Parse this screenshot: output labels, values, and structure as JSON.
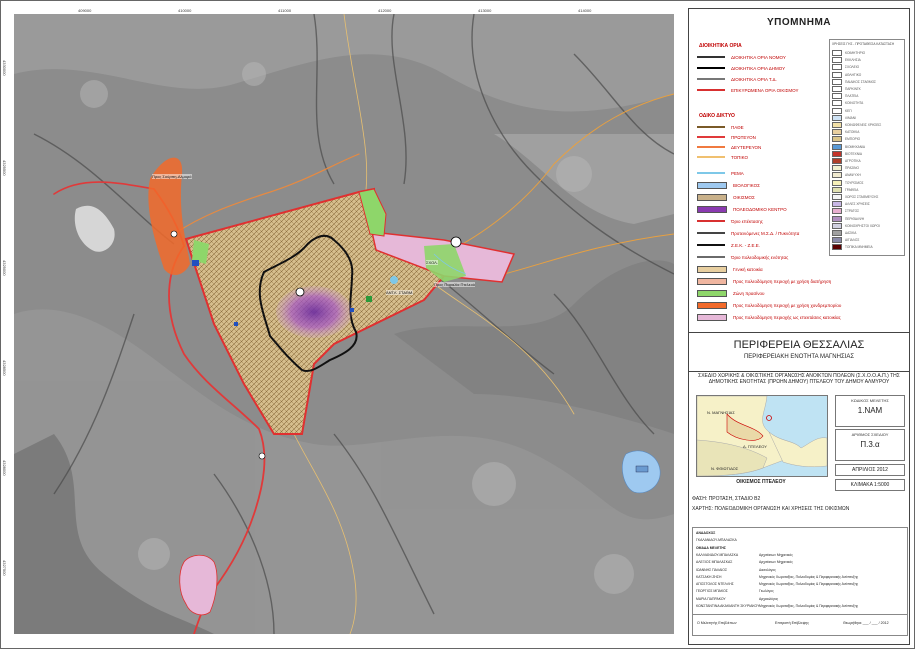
{
  "legend": {
    "title": "ΥΠΟΜΝΗΜΑ",
    "admin_heading": "ΔΙΟΙΚΗΤΙΚΑ ΟΡΙΑ",
    "admin_items": [
      {
        "label": "ΔΙΟΙΚΗΤΙΚΑ ΟΡΙΑ ΝΟΜΟΥ",
        "color": "#333333"
      },
      {
        "label": "ΔΙΟΙΚΗΤΙΚΑ ΟΡΙΑ ΔΗΜΟΥ",
        "color": "#000000"
      },
      {
        "label": "ΔΙΟΙΚΗΤΙΚΑ ΟΡΙΑ Τ.Δ.",
        "color": "#777777"
      },
      {
        "label": "ΕΠΙΚΥΡΩΜΕΝΑ ΟΡΙΑ ΟΙΚΙΣΜΟΥ",
        "color": "#d83030"
      }
    ],
    "road_heading": "ΟΔΙΚΟ ΔΙΚΤΥΟ",
    "road_items": [
      {
        "label": "ΠΑΘΕ",
        "color": "#7a5a28"
      },
      {
        "label": "ΠΡΩΤΕΥΟΝ",
        "color": "#e03a3a"
      },
      {
        "label": "ΔΕΥΤΕΡΕΥΟΝ",
        "color": "#f07a40"
      },
      {
        "label": "ΤΟΠΙΚΟ",
        "color": "#f0c070"
      }
    ],
    "other_items": [
      {
        "label": "ΡΕΜΑ",
        "color": "#7ec8e8",
        "kind": "line"
      },
      {
        "label": "ΒΙΟΛΟΓΙΚΟΣ",
        "color": "#9ec9f0",
        "kind": "fill"
      },
      {
        "label": "ΟΙΚΙΣΜΟΣ",
        "color": "#c9b18a",
        "kind": "fill"
      },
      {
        "label": "ΠΟΛΕΟΔΟΜΙΚΟ ΚΕΝΤΡΟ",
        "color": "#8a3ab0",
        "kind": "fill"
      },
      {
        "label": "Όριο επέκτασης",
        "color": "#d83030",
        "kind": "line"
      },
      {
        "label": "Προτεινόμενες Μ.Σ.Δ. / Πυκνότητα",
        "color": "#444444",
        "kind": "line"
      },
      {
        "label": "Ζ.Ε.Κ. - Ζ.Ε.Ε.",
        "color": "#111111",
        "kind": "line"
      },
      {
        "label": "Όριο πολεοδομικής ενότητας",
        "color": "#6a6a6a",
        "kind": "line"
      },
      {
        "label": "Γενική κατοικία",
        "color": "#e8cfa0",
        "kind": "fill"
      },
      {
        "label": "Προς πολεοδόμηση περιοχή με χρήση διατήρηση",
        "color": "#f0b6a0",
        "kind": "fill"
      },
      {
        "label": "Ζώνη πρασίνου",
        "color": "#8ed66a",
        "kind": "fill"
      },
      {
        "label": "Προς πολεοδόμηση περιοχή με χρήση χονδρεμπορίου",
        "color": "#f26a2a",
        "kind": "fill"
      },
      {
        "label": "Προς πολεοδόμηση περιοχής ως επεκτάσεις κατοικίας",
        "color": "#e6b8d8",
        "kind": "fill"
      }
    ],
    "right_table_title": "ΧΡΗΣΕΙΣ ΓΗΣ - ΠΡΟΤΑΘΕΙΣΑ ΚΑΤΑΣΤΑΣΗ",
    "right_table": [
      {
        "label": "ΚΟΙΜΗΤΗΡΙΟ",
        "color": "#ffffff"
      },
      {
        "label": "ΕΚΚΛΗΣΙΑ",
        "color": "#ffffff"
      },
      {
        "label": "ΣΧΟΛΕΙΟ",
        "color": "#ffffff"
      },
      {
        "label": "ΑΘΛΗΤΙΚΟ",
        "color": "#ffffff"
      },
      {
        "label": "ΠΑΙΔΙΚΟΣ ΣΤΑΘΜΟΣ",
        "color": "#ffffff"
      },
      {
        "label": "ΠΑΡΚΙΝΓΚ",
        "color": "#ffffff"
      },
      {
        "label": "ΠΛΑΤΕΙΑ",
        "color": "#ffffff"
      },
      {
        "label": "ΚΟΙΝΟΤΗΤΑ",
        "color": "#ffffff"
      },
      {
        "label": "ΚΕΠ",
        "color": "#ffffff"
      },
      {
        "label": "ΛΙΜΑΝΙ",
        "color": "#cfe3f5"
      },
      {
        "label": "ΚΟΙΝΩΦΕΛΕΙΣ ΧΡΗΣΕΙΣ",
        "color": "#f3e1a8"
      },
      {
        "label": "ΚΑΤΟΙΚΙΑ",
        "color": "#e8cfa0"
      },
      {
        "label": "ΕΜΠΟΡΙΟ",
        "color": "#d9c48a"
      },
      {
        "label": "ΒΙΟΜΗΧΑΝΙΑ",
        "color": "#5a9ad6"
      },
      {
        "label": "ΒΙΟΤΕΧΝΙΑ",
        "color": "#c4342a"
      },
      {
        "label": "ΑΓΡΟΤΙΚΑ",
        "color": "#b0402a"
      },
      {
        "label": "ΠΡΑΣΙΝΟ",
        "color": "#f2f2d0"
      },
      {
        "label": "ΑΝΑΨΥΧΗ",
        "color": "#f0ead0"
      },
      {
        "label": "ΤΟΥΡΙΣΜΟΣ",
        "color": "#f6f0b8"
      },
      {
        "label": "ΓΡΑΦΕΙΑ",
        "color": "#e0e0b0"
      },
      {
        "label": "ΧΩΡΟΣ ΣΤΑΘΜΕΥΣΗΣ",
        "color": "#f5f5f5"
      },
      {
        "label": "ΑΛΛΕΣ ΧΡΗΣΕΙΣ",
        "color": "#c9b8e6"
      },
      {
        "label": "ΣΤΡΑΤΟΣ",
        "color": "#e8b0d0"
      },
      {
        "label": "ΠΕΡΙΘΑΛΨΗ",
        "color": "#b090c0"
      },
      {
        "label": "ΚΟΙΝΟΧΡΗΣΤΟΙ ΧΩΡΟΙ",
        "color": "#d0d0e0"
      },
      {
        "label": "ΔΑΣΙΚΑ",
        "color": "#a0a0a0"
      },
      {
        "label": "ΑΙΓΙΑΛΟΣ",
        "color": "#8a8aa8"
      },
      {
        "label": "ΤΟΠΙΚΑ ΜΝΗΜΕΙΑ",
        "color": "#5a0000"
      }
    ]
  },
  "title": {
    "region": "ΠΕΡΙΦΕΡΕΙΑ ΘΕΣΣΑΛΙΑΣ",
    "unit": "ΠΕΡΙΦΕΡΕΙΑΚΗ ΕΝΟΤΗΤΑ ΜΑΓΝΗΣΙΑΣ",
    "study": "ΣΧΕΔΙΟ ΧΩΡΙΚΗΣ & ΟΙΚΙΣΤΙΚΗΣ ΟΡΓΑΝΩΣΗΣ ΑΝΟΙΚΤΩΝ ΠΟΛΕΩΝ (Σ.Χ.Ο.Ο.Α.Π.) ΤΗΣ ΔΗΜΟΤΙΚΗΣ ΕΝΟΤΗΤΑΣ (ΠΡΩΗΝ ΔΗΜΟΥ) ΠΤΕΛΕΟΥ ΤΟΥ ΔΗΜΟΥ ΑΛΜΥΡΟΥ"
  },
  "inset": {
    "caption": "ΟΙΚΙΣΜΟΣ ΠΤΕΛΕΟΥ",
    "labels": [
      "Ν. ΜΑΓΝΗΣΙΑΣ",
      "Δ. ΠΤΕΛΕΟΥ",
      "Ν. ΦΘΙΩΤΙΔΟΣ"
    ]
  },
  "meta": {
    "study_code_label": "ΚΩΔΙΚΟΣ ΜΕΛΕΤΗΣ",
    "study_code": "1.NAM",
    "drawing_no_label": "ΑΡΙΘΜΟΣ ΣΧΕΔΙΟΥ",
    "drawing_no": "Π.3.α",
    "date": "ΑΠΡΙΛΙΟΣ 2012",
    "scale": "ΚΛΙΜΑΚΑ 1:5000"
  },
  "phase": "ΦΑΣΗ: ΠΡΟΤΑΣΗ, ΣΤΑΔΙΟ Β2",
  "map_title": "ΧΑΡΤΗΣ: ΠΟΛΕΟΔΟΜΙΚΗ ΟΡΓΑΝΩΣΗ ΚΑΙ ΧΡΗΣΕΙΣ ΤΗΣ ΟΙΚΙΣΜΩΝ",
  "credits": [
    {
      "name": "ΑΝΑΔΟΧΟΣ",
      "role": ""
    },
    {
      "name": "ΓΚΑΛΑΝΙΔΟΥ-ΜΠΑΛΑΣΚΑ",
      "role": ""
    },
    {
      "name": "ΟΜΑΔΑ ΜΕΛΕΤΗΣ",
      "role": ""
    },
    {
      "name": "ΚΑΛΛΙΑΝΙΔΟΥ-ΜΠΑΛΑΣΚΑ",
      "role": "Αρχιτέκτων Μηχανικός"
    },
    {
      "name": "ΑΛΕΞΙΟΣ ΜΠΑΛΑΣΚΑΣ",
      "role": "Αρχιτέκτων Μηχανικός"
    },
    {
      "name": "ΙΩΑΝΝΗΣ ΠΑΛΑΙΟΣ",
      "role": "Δασολόγος"
    },
    {
      "name": "ΚΑΤΣΑΚΗ ΖΗΣΗ",
      "role": "Μηχανικός Χωροταξίας, Πολεοδομίας & Περιφερειακής Ανάπτυξης"
    },
    {
      "name": "ΑΠΟΣΤΟΛΟΣ ΝΤΕΛΛΗΣ",
      "role": "Μηχανικός Χωροταξίας, Πολεοδομίας & Περιφερειακής Ανάπτυξης"
    },
    {
      "name": "ΓΕΩΡΓΙΟΣ ΜΠΑΚΟΣ",
      "role": "Γεωλόγος"
    },
    {
      "name": "ΜΑΡΙΑ ΠΑΠΡΑΚΟΥ",
      "role": "Αρχαιολόγος"
    },
    {
      "name": "ΚΩΝΣΤΑΝΤΙΝΑ ΑΚΑΚΙΑΝΤΗ ΣΚΥΡΙΑΚΟΥ",
      "role": "Μηχανικός Χωροταξίας, Πολεοδομίας & Περιφερειακής Ανάπτυξης"
    }
  ],
  "signature": {
    "checker": "Ο Μελετητής Επιβλέπων",
    "committee": "Επιτροπή Επίβλεψης",
    "approved": "Θεωρήθηκε ___ / ___ / 2012"
  },
  "map_labels": {
    "road_top": "Προς Σούρπη-Αλμυρό",
    "road_east": "Προς Παραλία Πτελεού",
    "station": "ΑΝΤΛ. ΣΤΑΘΜ.",
    "school": "ΣΧΟΛ."
  },
  "map_ticks": {
    "top": [
      "409000",
      "410000",
      "411000",
      "412000",
      "413000",
      "414000"
    ],
    "left": [
      "4330000",
      "4329500",
      "4329000",
      "4328500",
      "4328000",
      "4327500"
    ]
  }
}
